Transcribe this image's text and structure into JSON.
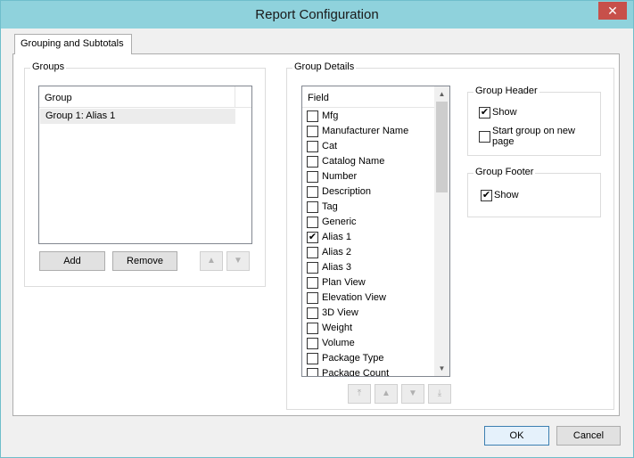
{
  "window": {
    "title": "Report Configuration"
  },
  "tab": {
    "label": "Grouping and Subtotals"
  },
  "groups": {
    "label": "Groups",
    "column_header": "Group",
    "rows": [
      "Group 1: Alias 1"
    ],
    "add_label": "Add",
    "remove_label": "Remove",
    "move_up_icon": "▲",
    "move_down_icon": "▼"
  },
  "group_details": {
    "label": "Group Details",
    "field_header": "Field",
    "fields": [
      {
        "label": "Mfg",
        "checked": false
      },
      {
        "label": "Manufacturer Name",
        "checked": false
      },
      {
        "label": "Cat",
        "checked": false
      },
      {
        "label": "Catalog Name",
        "checked": false
      },
      {
        "label": "Number",
        "checked": false
      },
      {
        "label": "Description",
        "checked": false
      },
      {
        "label": "Tag",
        "checked": false
      },
      {
        "label": "Generic",
        "checked": false
      },
      {
        "label": "Alias 1",
        "checked": true
      },
      {
        "label": "Alias 2",
        "checked": false
      },
      {
        "label": "Alias 3",
        "checked": false
      },
      {
        "label": "Plan View",
        "checked": false
      },
      {
        "label": "Elevation View",
        "checked": false
      },
      {
        "label": "3D View",
        "checked": false
      },
      {
        "label": "Weight",
        "checked": false
      },
      {
        "label": "Volume",
        "checked": false
      },
      {
        "label": "Package Type",
        "checked": false
      },
      {
        "label": "Package Count",
        "checked": false
      }
    ],
    "move_top_icon": "⤒",
    "move_up_icon": "▲",
    "move_down_icon": "▼",
    "move_bottom_icon": "⤓"
  },
  "group_header": {
    "label": "Group Header",
    "show_label": "Show",
    "show_checked": true,
    "start_new_page_label": "Start group on new page",
    "start_new_page_checked": false
  },
  "group_footer": {
    "label": "Group Footer",
    "show_label": "Show",
    "show_checked": true
  },
  "footer": {
    "ok_label": "OK",
    "cancel_label": "Cancel"
  },
  "check_glyph": "✔",
  "close_glyph": "✕",
  "scroll_up_glyph": "▲",
  "scroll_down_glyph": "▼"
}
